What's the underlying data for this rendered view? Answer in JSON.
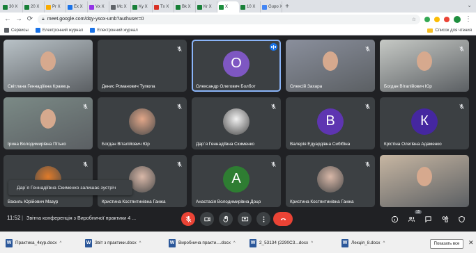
{
  "browser": {
    "tabs": [
      {
        "label": "30 X",
        "color": "#188038"
      },
      {
        "label": "20 X",
        "color": "#188038"
      },
      {
        "label": "Pr X",
        "color": "#f9ab00"
      },
      {
        "label": "Ex X",
        "color": "#1a73e8"
      },
      {
        "label": "Vx X",
        "color": "#9334e6"
      },
      {
        "label": "Mc X",
        "color": "#5f6368"
      },
      {
        "label": "Ky X",
        "color": "#188038"
      },
      {
        "label": "Tx X",
        "color": "#d93025"
      },
      {
        "label": "Bk X",
        "color": "#188038"
      },
      {
        "label": "Kr X",
        "color": "#188038"
      },
      {
        "label": "X",
        "color": "#1e8e3e"
      },
      {
        "label": "10 X",
        "color": "#188038"
      },
      {
        "label": "Gupo X",
        "color": "#4285f4"
      }
    ],
    "active_tab_index": 10,
    "new_tab": "+",
    "url": "meet.google.com/dqy-ysox-umb?authuser=0",
    "bookmarks_left": [
      "Сервисы",
      "Електронний журнал",
      "Електронний журнал"
    ],
    "bookmarks_right": "Список для чтения"
  },
  "participants": [
    {
      "name": "Світлана Геннадіївна Кравець",
      "kind": "video",
      "muted": false,
      "bg": "#b9c2c7"
    },
    {
      "name": "Денис Романович Тупюпа",
      "kind": "empty",
      "muted": true
    },
    {
      "name": "Олександр Олегович Болбот",
      "kind": "avatar",
      "letter": "О",
      "color": "#7e57c2",
      "muted": false,
      "speaking": true
    },
    {
      "name": "Олексій Захара",
      "kind": "video",
      "muted": true,
      "bg": "#8a8f9c"
    },
    {
      "name": "Богдан Віталійович Юр",
      "kind": "video",
      "muted": true,
      "bg": "#c6c9c5"
    },
    {
      "name": "Ірина Володимирівна Пітько",
      "kind": "video",
      "muted": true,
      "bg": "#7b8a86"
    },
    {
      "name": "Богдан Віталійович Юр",
      "kind": "photo",
      "muted": true,
      "photo_color": "#e2a789"
    },
    {
      "name": "Дар`я Геннадіївна Скименко",
      "kind": "photo",
      "muted": true,
      "photo_color": "#f2f2f2"
    },
    {
      "name": "Валерія Едуардівна Сибібіна",
      "kind": "avatar",
      "letter": "В",
      "color": "#5e35b1",
      "muted": true
    },
    {
      "name": "Крістіна Олегівна Адаменко",
      "kind": "avatar",
      "letter": "К",
      "color": "#4527a0",
      "muted": true
    },
    {
      "name": "Василь Юрійович Мазур",
      "kind": "photo",
      "muted": true,
      "photo_color": "#e07b2a"
    },
    {
      "name": "Кристина Костянтинівна Ганжа",
      "kind": "photo",
      "muted": true,
      "photo_color": "#d9b8a8"
    },
    {
      "name": "Анастасія Володимирівна Доцо",
      "kind": "avatar",
      "letter": "А",
      "color": "#2e7d32",
      "muted": true
    },
    {
      "name": "Кристина Костянтинівна Ганжа",
      "kind": "photo",
      "muted": true,
      "photo_color": "#d9b8a8"
    },
    {
      "name": "",
      "kind": "video",
      "muted": false,
      "bg": "#c7b6a2"
    }
  ],
  "toast": "Дар`я Геннадіївна Скименко залишає зустріч",
  "controls": {
    "time": "11:52",
    "separator": "|",
    "meeting_title": "Звітна конференція з Виробничої практики 4 ...",
    "people_count": "15"
  },
  "taskbar": {
    "items": [
      "Практика_4кур.docx",
      "Звіт з практики.docx",
      "Виробнича практи....docx",
      "2_53134 (2290СЗ...docx",
      "Лекція_8.docx"
    ],
    "show_all": "Показать все"
  },
  "colors": {
    "accent": "#8ab4f8",
    "danger": "#ea4335",
    "surface": "#3c4043",
    "background": "#202124"
  }
}
